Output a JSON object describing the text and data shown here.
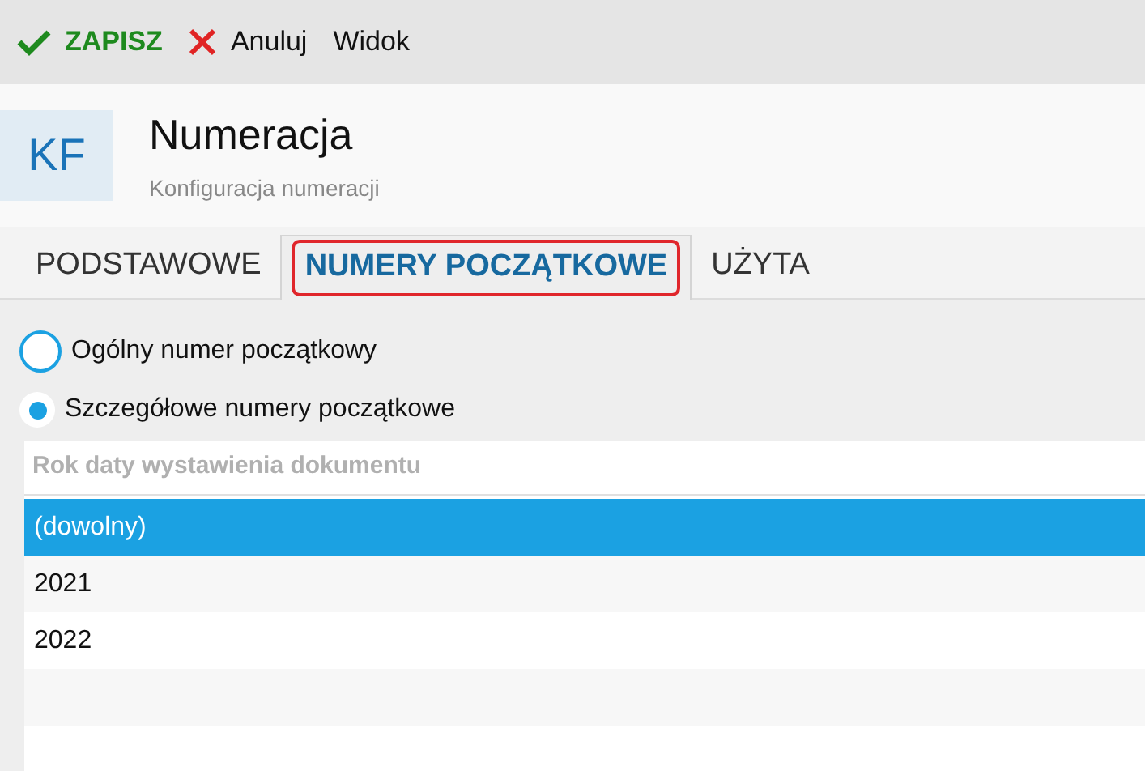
{
  "toolbar": [
    {
      "kind": "save",
      "label": "ZAPISZ"
    },
    {
      "kind": "cancel",
      "label": "Anuluj"
    },
    {
      "kind": "plain",
      "label": "Widok"
    }
  ],
  "header": {
    "badge": "KF",
    "title": "Numeracja",
    "subtitle": "Konfiguracja numeracji"
  },
  "tabs": [
    {
      "label": "PODSTAWOWE",
      "selected": false
    },
    {
      "label": "NUMERY POCZĄTKOWE",
      "selected": true
    },
    {
      "label": "UŻYTA",
      "selected": false
    }
  ],
  "options": [
    {
      "label": "Ogólny numer początkowy",
      "selected": false
    },
    {
      "label": "Szczegółowe numery początkowe",
      "selected": true
    }
  ],
  "list": {
    "column_placeholder": "Rok daty wystawienia dokumentu",
    "rows": [
      {
        "label": "(dowolny)",
        "selected": true
      },
      {
        "label": "2021",
        "selected": false
      },
      {
        "label": "2022",
        "selected": false
      }
    ]
  }
}
